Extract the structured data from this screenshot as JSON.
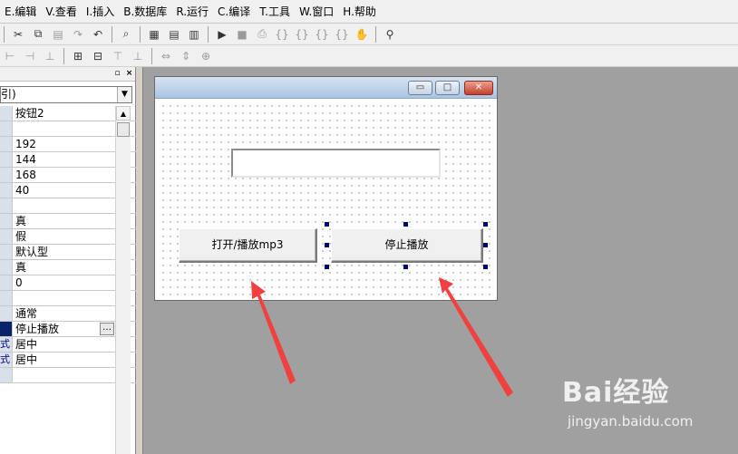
{
  "menubar": {
    "items": [
      "E.编辑",
      "V.查看",
      "I.插入",
      "B.数据库",
      "R.运行",
      "C.编译",
      "T.工具",
      "W.窗口",
      "H.帮助"
    ]
  },
  "toolbar1": {
    "icons": [
      "cut-icon",
      "copy-icon",
      "paste-icon",
      "redo-icon",
      "undo-icon",
      "find-icon",
      "layout-icon-1",
      "layout-icon-2",
      "layout-icon-3",
      "run-icon",
      "stop-icon",
      "step-icon-1",
      "step-icon-2",
      "step-icon-3",
      "step-icon-4",
      "step-icon-5",
      "hand-icon",
      "debug-icon"
    ]
  },
  "toolbar2": {
    "icons": [
      "align-icon-1",
      "align-icon-2",
      "align-icon-3",
      "center-h-icon",
      "center-v-icon",
      "align-icon-4",
      "align-icon-5",
      "width-icon",
      "height-icon",
      "size-icon"
    ]
  },
  "property_panel": {
    "object_selector": "引)",
    "rows": [
      {
        "name": "",
        "value": "按钮2"
      },
      {
        "name": "",
        "value": ""
      },
      {
        "name": "",
        "value": "192"
      },
      {
        "name": "",
        "value": "144"
      },
      {
        "name": "",
        "value": "168"
      },
      {
        "name": "",
        "value": "40"
      },
      {
        "name": "",
        "value": ""
      },
      {
        "name": "",
        "value": "真"
      },
      {
        "name": "",
        "value": "假"
      },
      {
        "name": "",
        "value": "默认型"
      },
      {
        "name": "",
        "value": "真"
      },
      {
        "name": "",
        "value": "0"
      },
      {
        "name": "",
        "value": ""
      },
      {
        "name": "",
        "value": "通常"
      },
      {
        "name": "",
        "value": "停止播放"
      },
      {
        "name": "式",
        "value": "居中"
      },
      {
        "name": "式",
        "value": "居中"
      },
      {
        "name": "",
        "value": ""
      }
    ]
  },
  "form": {
    "button_play_label": "打开/播放mp3",
    "button_stop_label": "停止播放",
    "textbox_value": ""
  },
  "watermark": {
    "logo": "Bai经验",
    "url": "jingyan.baidu.com"
  },
  "colors": {
    "arrow": "#f04040",
    "selection_handle": "#00007a",
    "design_background": "#a0a0a0"
  }
}
